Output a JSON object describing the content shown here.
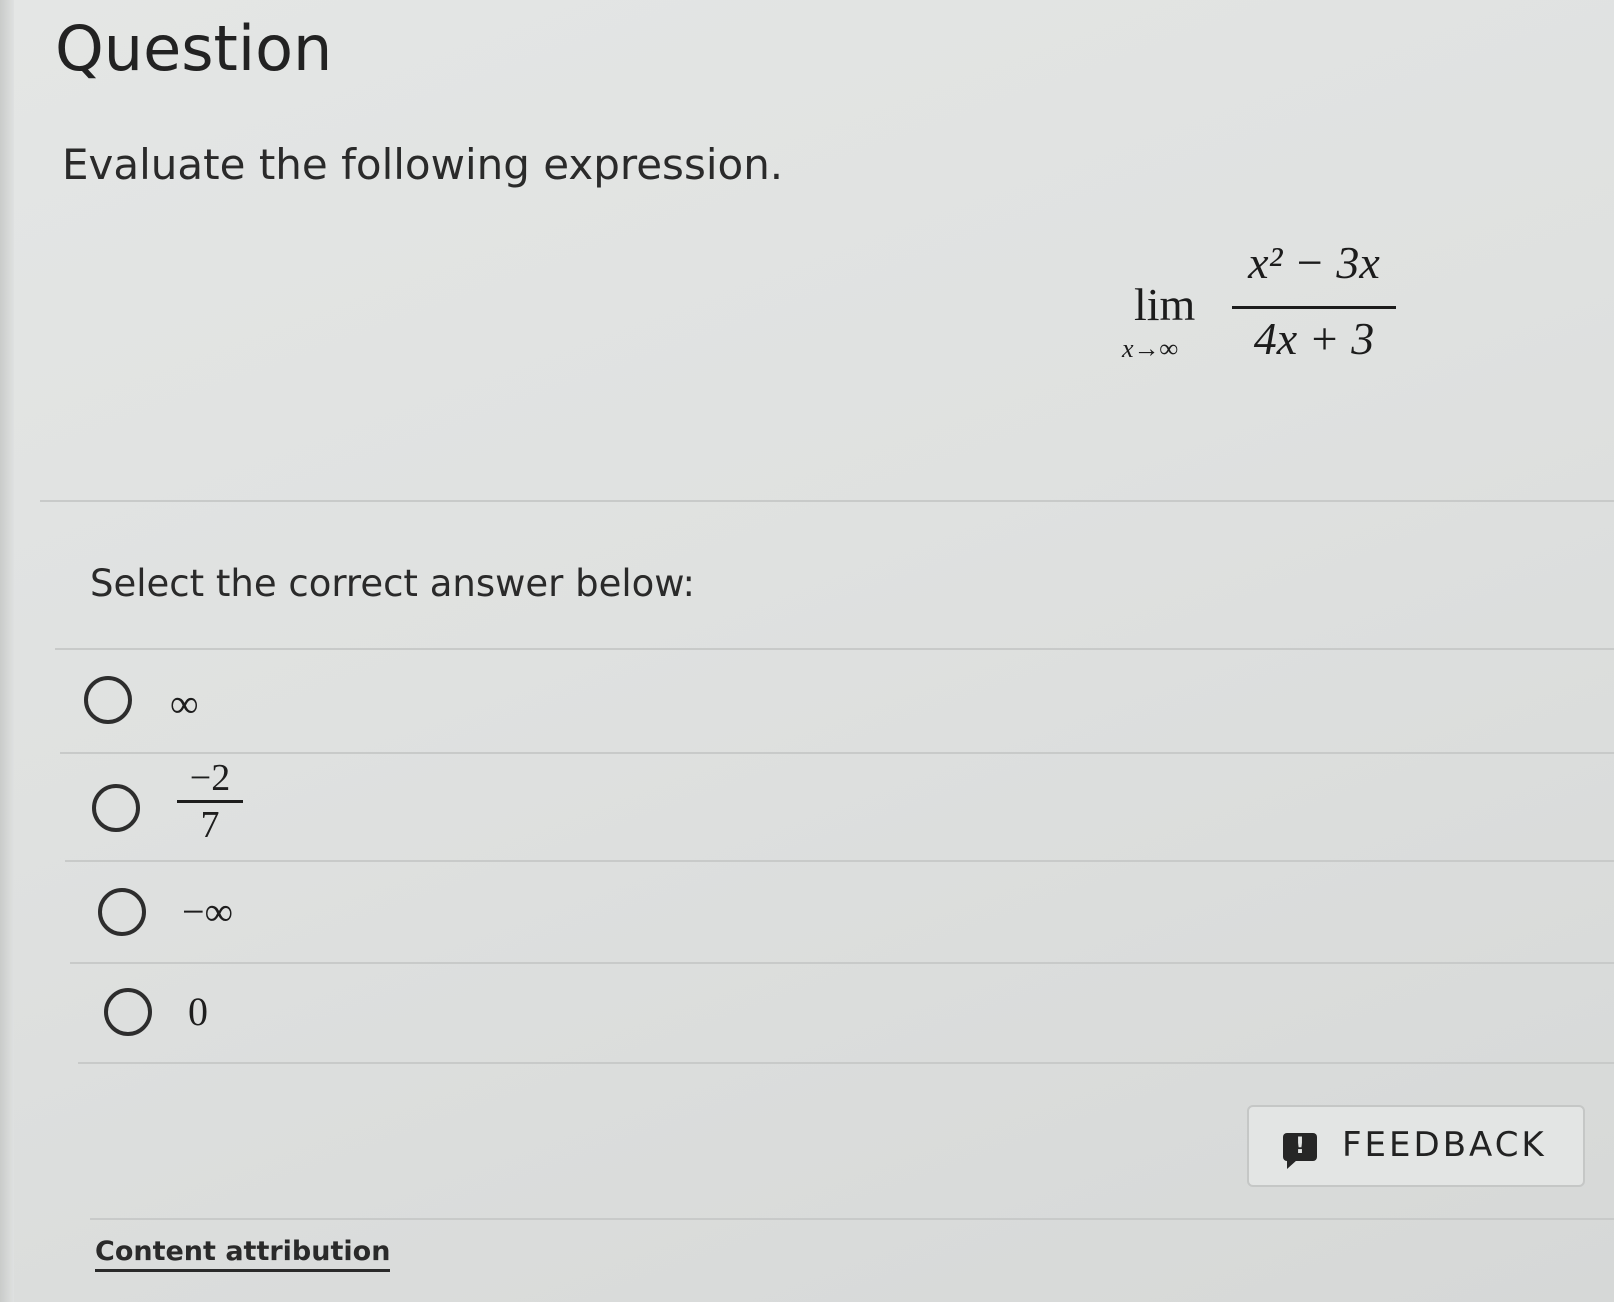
{
  "page": {
    "title": "Question",
    "prompt": "Evaluate the following expression."
  },
  "expression": {
    "lim": "lim",
    "lim_subscript": "x→∞",
    "numerator": "x² − 3x",
    "denominator": "4x + 3"
  },
  "answers": {
    "label": "Select the correct answer below:",
    "options": [
      {
        "text": "∞"
      },
      {
        "numerator": "−2",
        "denominator": "7"
      },
      {
        "text": "−∞"
      },
      {
        "text": "0"
      }
    ]
  },
  "feedback": {
    "icon": "exclamation-speech-bubble",
    "icon_glyph": "!",
    "label": "FEEDBACK"
  },
  "footer": {
    "attribution": "Content attribution"
  }
}
